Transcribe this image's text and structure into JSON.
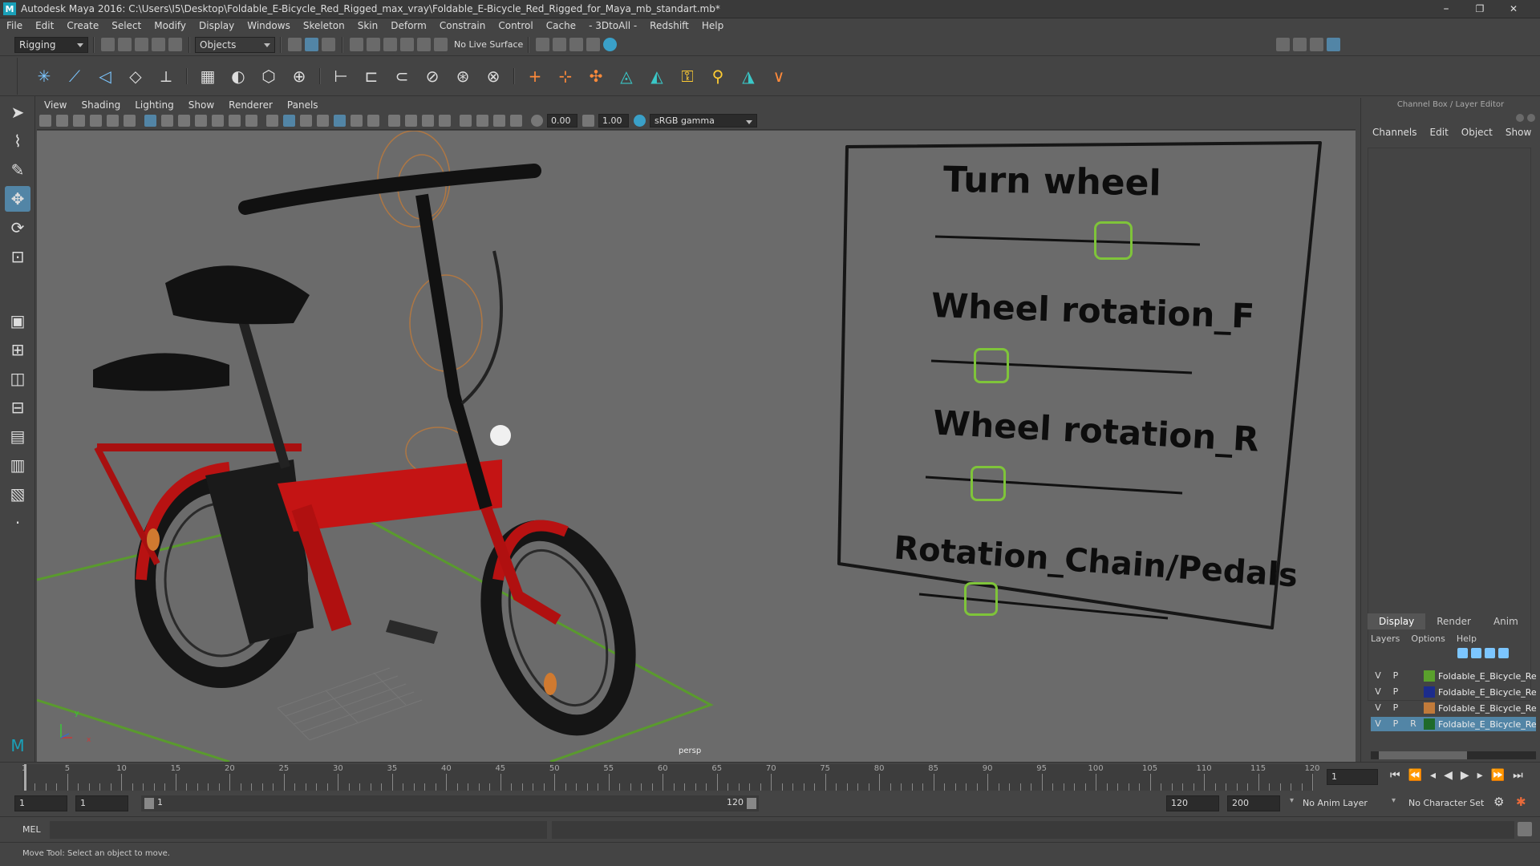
{
  "window": {
    "title": "Autodesk Maya 2016: C:\\Users\\I5\\Desktop\\Foldable_E-Bicycle_Red_Rigged_max_vray\\Foldable_E-Bicycle_Red_Rigged_for_Maya_mb_standart.mb*",
    "logo": "M",
    "minimize": "–",
    "restore": "❐",
    "close": "✕"
  },
  "menubar": [
    "File",
    "Edit",
    "Create",
    "Select",
    "Modify",
    "Display",
    "Windows",
    "Skeleton",
    "Skin",
    "Deform",
    "Constrain",
    "Control",
    "Cache",
    "- 3DtoAll -",
    "Redshift",
    "Help"
  ],
  "statusline": {
    "mode": "Rigging",
    "select_mode": "Objects",
    "live_surface": "No Live Surface"
  },
  "viewport": {
    "menu": [
      "View",
      "Shading",
      "Lighting",
      "Show",
      "Renderer",
      "Panels"
    ],
    "near": "0.00",
    "far": "1.00",
    "colorspace": "sRGB gamma",
    "camera": "persp",
    "axis_y": "y",
    "axis_x": "x"
  },
  "rig_panel": {
    "labels": [
      "Turn wheel",
      "Wheel rotation_F",
      "Wheel rotation_R",
      "Rotation_Chain/Pedals"
    ],
    "handle_color": "#7fc43a"
  },
  "channel_box": {
    "header": "Channel Box / Layer Editor",
    "menu": [
      "Channels",
      "Edit",
      "Object",
      "Show"
    ],
    "tabs": [
      "Display",
      "Render",
      "Anim"
    ],
    "layer_menu": [
      "Layers",
      "Options",
      "Help"
    ],
    "layers": [
      {
        "v": "V",
        "p": "P",
        "r": "",
        "color": "#5aa02c",
        "name": "Foldable_E_Bicycle_Red"
      },
      {
        "v": "V",
        "p": "P",
        "r": "",
        "color": "#1c2c8c",
        "name": "Foldable_E_Bicycle_Red"
      },
      {
        "v": "V",
        "p": "P",
        "r": "",
        "color": "#c07a3a",
        "name": "Foldable_E_Bicycle_Red"
      },
      {
        "v": "V",
        "p": "P",
        "r": "R",
        "color": "#1f6a2a",
        "name": "Foldable_E_Bicycle_Red"
      }
    ]
  },
  "timeline": {
    "ticks": [
      "1",
      "5",
      "10",
      "15",
      "20",
      "25",
      "30",
      "35",
      "40",
      "45",
      "50",
      "55",
      "60",
      "65",
      "70",
      "75",
      "80",
      "85",
      "90",
      "95",
      "100",
      "105",
      "110",
      "115",
      "120"
    ],
    "current_frame": "1"
  },
  "range": {
    "start": "1",
    "playback_start": "1",
    "slider_start": "1",
    "slider_end": "120",
    "playback_end": "120",
    "end": "200",
    "anim_layer": "No Anim Layer",
    "char_set": "No Character Set"
  },
  "cmd": {
    "lang": "MEL"
  },
  "help": {
    "text": "Move Tool: Select an object to move."
  }
}
